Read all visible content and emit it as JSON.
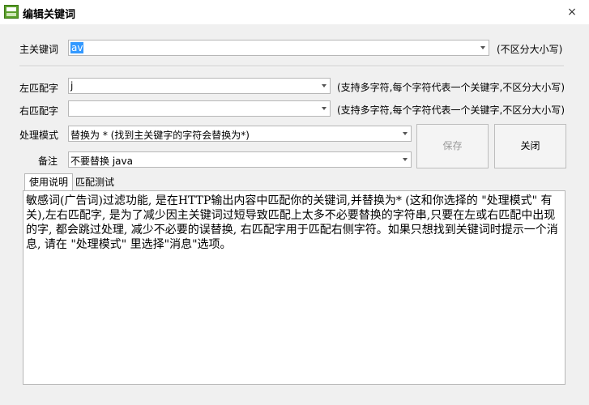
{
  "window": {
    "title": "编辑关键词",
    "close_glyph": "×"
  },
  "main_keyword": {
    "label": "主关键词",
    "value": "av",
    "hint": "(不区分大小写)"
  },
  "left_match": {
    "label": "左匹配字",
    "value": "j",
    "hint": "(支持多字符,每个字符代表一个关键字,不区分大小写)"
  },
  "right_match": {
    "label": "右匹配字",
    "value": "",
    "hint": "(支持多字符,每个字符代表一个关键字,不区分大小写)"
  },
  "mode": {
    "label": "处理模式",
    "value": "替换为 *     (找到主关键字的字符会替换为*)"
  },
  "note": {
    "label": "备注",
    "value": "不要替换 java"
  },
  "buttons": {
    "save": "保存",
    "close": "关闭"
  },
  "tabs": [
    {
      "label": "使用说明",
      "active": true
    },
    {
      "label": "匹配测试",
      "active": false
    }
  ],
  "help_text": "敏感词(广告词)过滤功能, 是在HTTP输出内容中匹配你的关键词,并替换为* (这和你选择的 \"处理模式\" 有关),左右匹配字, 是为了减少因主关键词过短导致匹配上太多不必要替换的字符串,只要在左或右匹配中出现的字, 都会跳过处理, 减少不必要的误替换, 右匹配字用于匹配右侧字符。如果只想找到关键词时提示一个消息, 请在 \"处理模式\" 里选择\"消息\"选项。"
}
